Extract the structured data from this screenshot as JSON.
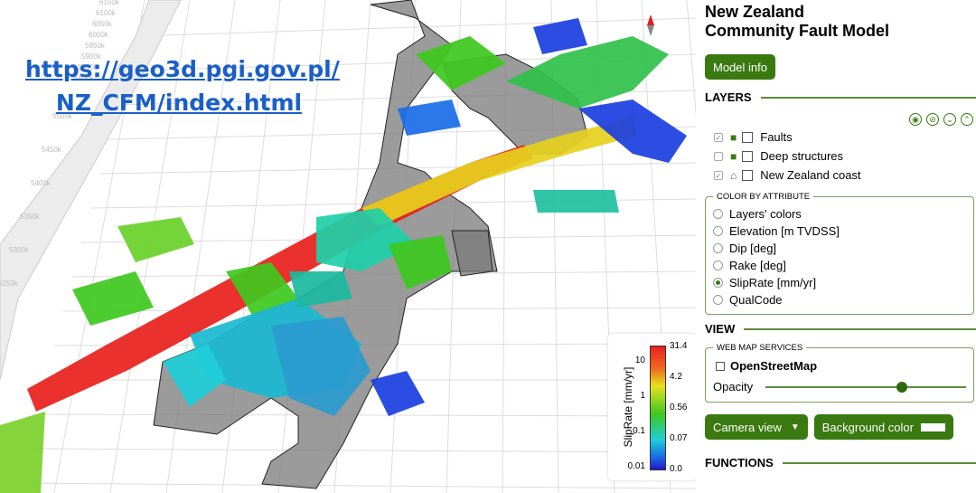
{
  "viewer": {
    "link_line1": "https://geo3d.pgi.gov.pl/",
    "link_line2": "NZ_CFM/index.html",
    "axis_labels": [
      "6150k",
      "6100k",
      "6050k",
      "6000k",
      "5950k",
      "5900k",
      "5850k",
      "5800k",
      "5500k",
      "5450k",
      "5400k",
      "5350k",
      "5300k",
      "5250k"
    ],
    "compass_label": "N",
    "legend": {
      "title": "SlipRate [mm/yr]",
      "left_ticks": [
        "10",
        "1",
        "0.1",
        "0.01"
      ],
      "right_ticks": [
        "31.4",
        "4.2",
        "0.56",
        "0.07",
        "0.0"
      ]
    }
  },
  "panel": {
    "title_line1": "New Zealand",
    "title_line2": "Community Fault Model",
    "model_info": "Model info",
    "layers_heading": "LAYERS",
    "layers": [
      {
        "label": "Faults",
        "checked": true
      },
      {
        "label": "Deep structures",
        "checked": false
      },
      {
        "label": "New Zealand coast",
        "checked": true
      }
    ],
    "color_by": {
      "legend": "COLOR BY ATTRIBUTE",
      "options": [
        "Layers' colors",
        "Elevation [m TVDSS]",
        "Dip [deg]",
        "Rake [deg]",
        "SlipRate [mm/yr]",
        "QualCode"
      ],
      "selected": "SlipRate [mm/yr]"
    },
    "view_heading": "VIEW",
    "wms": {
      "legend": "WEB MAP SERVICES",
      "osm": "OpenStreetMap",
      "opacity_label": "Opacity",
      "opacity": 0.68
    },
    "camera_view": "Camera view",
    "background_color": "Background color",
    "background_swatch": "#ffffff",
    "functions_heading": "FUNCTIONS",
    "accent": "#3a7a10"
  }
}
